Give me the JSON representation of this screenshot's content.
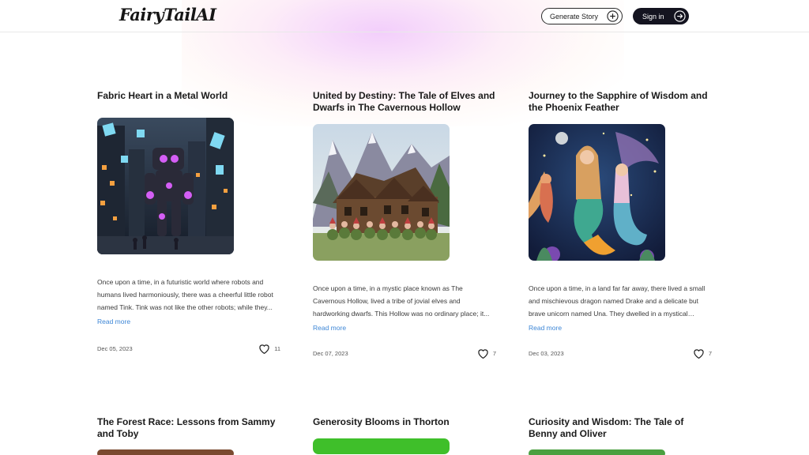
{
  "header": {
    "logo": "FairyTailAI",
    "generate_label": "Generate Story",
    "signin_label": "Sign in"
  },
  "stories": [
    {
      "title": "Fabric Heart in a Metal World",
      "excerpt": "Once upon a time, in a futuristic world where robots and humans lived harmoniously, there was a cheerful little robot named Tink. Tink was not like the other robots; while they...",
      "read_more": "Read more",
      "date": "Dec 05, 2023",
      "likes": "11",
      "image": "robot-city-illustration"
    },
    {
      "title": "United by Destiny: The Tale of Elves and Dwarfs in The Cavernous Hollow",
      "excerpt": "Once upon a time, in a mystic place known as The Cavernous Hollow, lived a tribe of jovial elves and hardworking dwarfs. This Hollow was no ordinary place; it...",
      "read_more": "Read more",
      "date": "Dec 07, 2023",
      "likes": "7",
      "image": "elves-dwarfs-lodge-illustration"
    },
    {
      "title": "Journey to the Sapphire of Wisdom and the Phoenix Feather",
      "excerpt": "Once upon a time, in a land far far away, there lived a small and mischievous dragon named Drake and a delicate but brave unicorn named Una. They dwelled in a mystical forest...",
      "read_more": "Read more",
      "date": "Dec 03, 2023",
      "likes": "7",
      "image": "mermaids-illustration"
    },
    {
      "title": "The Forest Race: Lessons from Sammy and Toby"
    },
    {
      "title": "Generosity Blooms in Thorton"
    },
    {
      "title": "Curiosity and Wisdom: The Tale of Benny and Oliver"
    }
  ]
}
